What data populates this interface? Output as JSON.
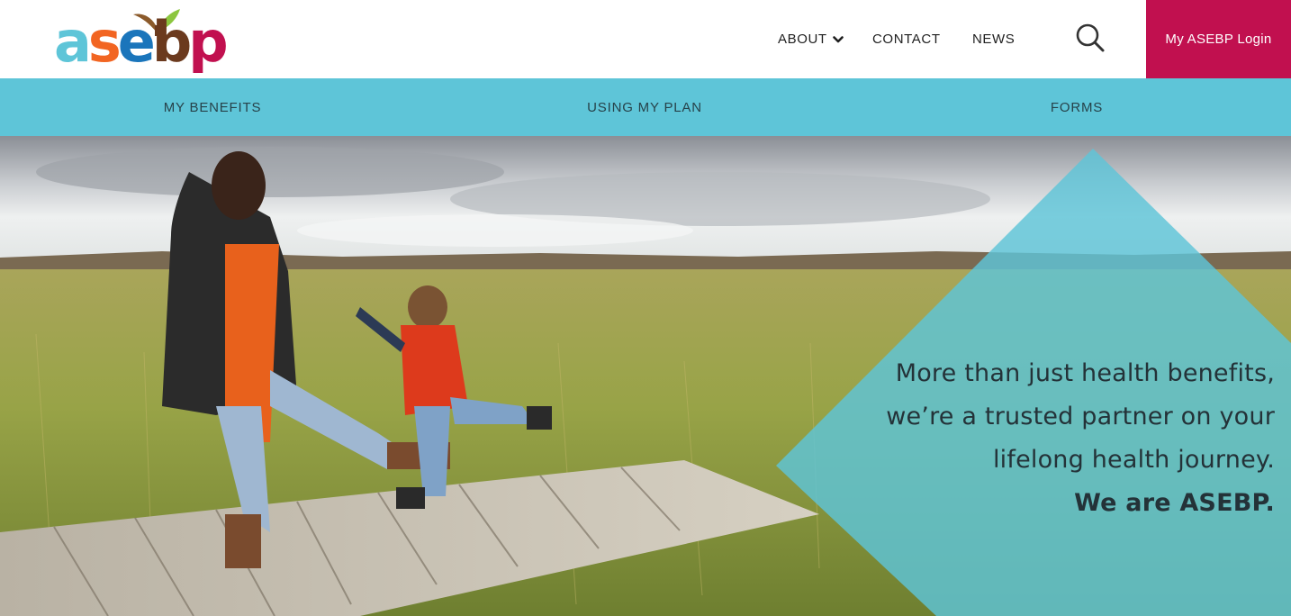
{
  "brand": {
    "logo_letters": [
      "a",
      "s",
      "e",
      "b",
      "p"
    ],
    "logo_colors": [
      "#5ec5d8",
      "#f26522",
      "#1a75bb",
      "#6b3a1e",
      "#c1104f"
    ],
    "leaf_colors": [
      "#8cc63f",
      "#8b5a2b"
    ],
    "primary_accent": "#c1104f",
    "subnav_color": "#5ec5d8"
  },
  "topnav": {
    "about_label": "ABOUT",
    "about_icon": "chevron-down-icon",
    "contact_label": "CONTACT",
    "news_label": "NEWS",
    "search_icon": "search-icon",
    "login_label": "My ASEBP Login"
  },
  "subnav": {
    "items": [
      {
        "label": "MY BENEFITS"
      },
      {
        "label": "USING MY PLAN"
      },
      {
        "label": "FORMS"
      }
    ]
  },
  "hero": {
    "line1": "More than just health benefits,",
    "line2": "we’re a trusted partner on your",
    "line3": "lifelong health journey.",
    "line4": "We are ASEBP.",
    "overlay_color": "#5ec5d8"
  }
}
